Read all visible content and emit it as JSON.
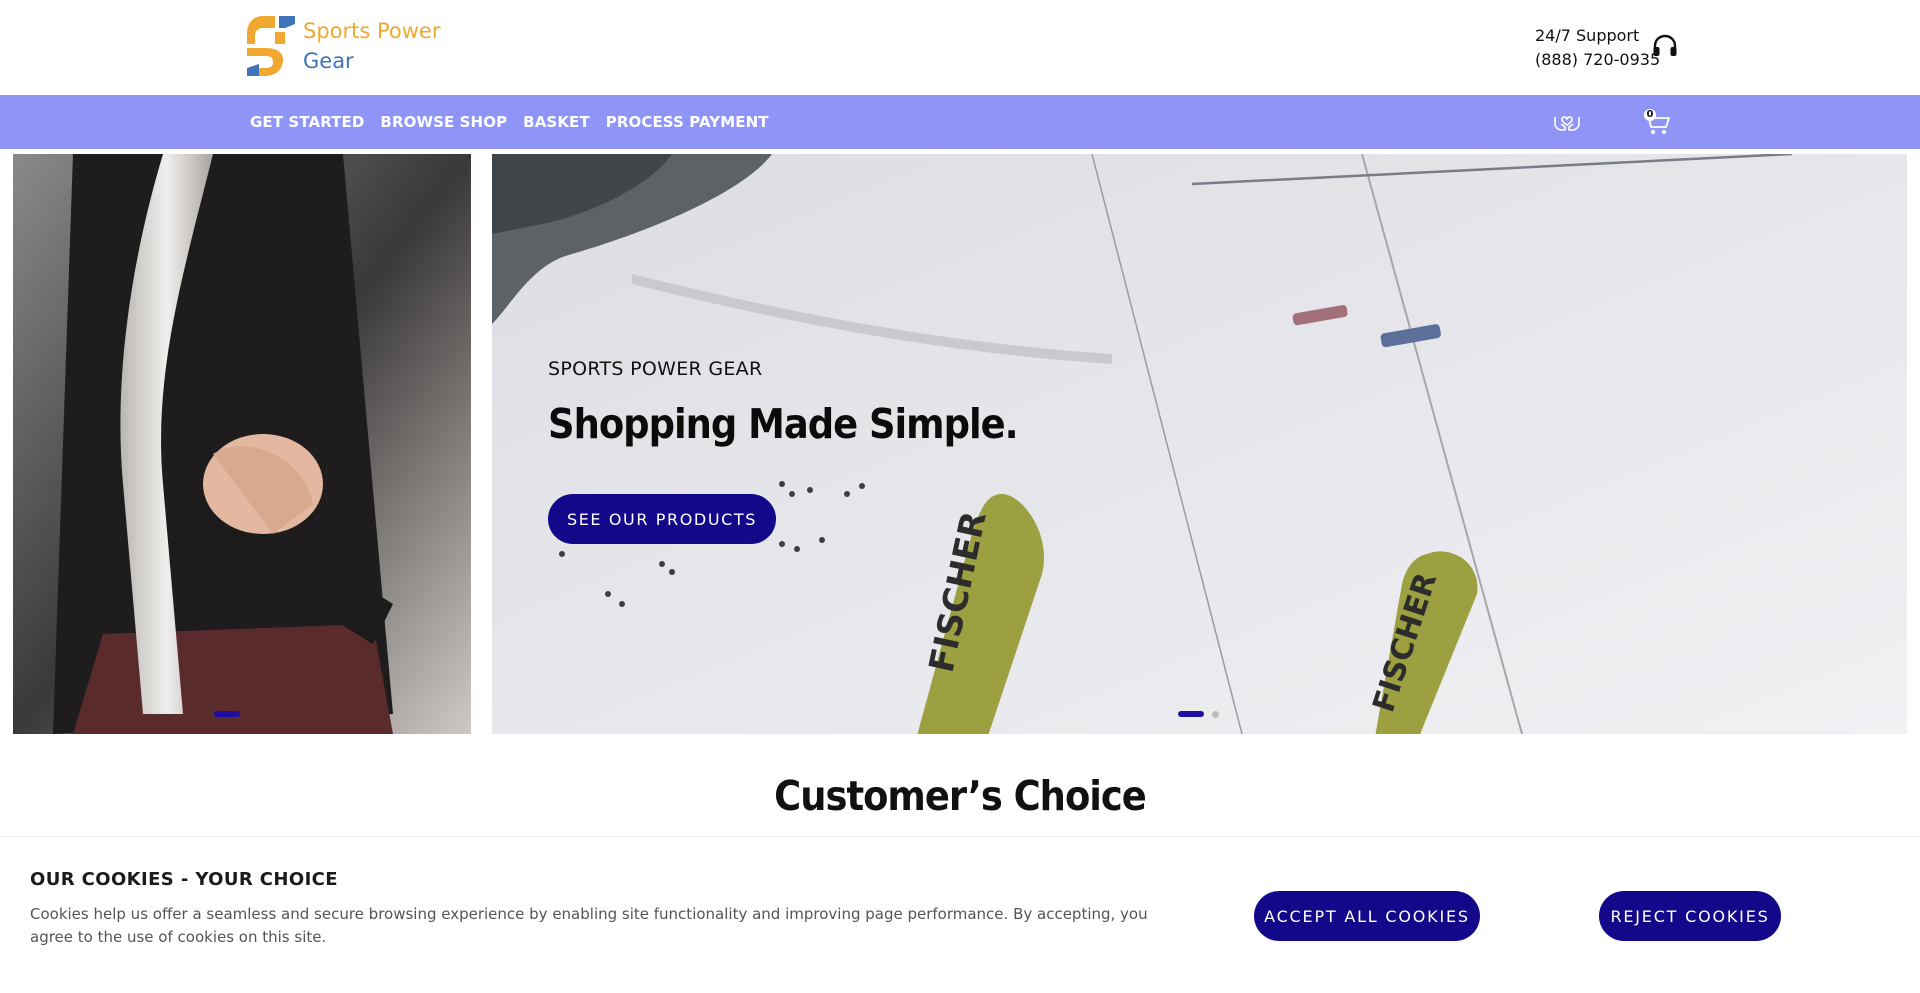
{
  "header": {
    "logo": {
      "line1": "Sports Power",
      "line2": "Gear",
      "colors": {
        "orange": "#f0a830",
        "blue": "#3f74b8"
      }
    },
    "support": {
      "label": "24/7 Support",
      "phone": "(888) 720-0935",
      "icon": "headphones-icon"
    }
  },
  "nav": {
    "background": "#8f95f7",
    "links": [
      "GET STARTED",
      "BROWSE SHOP",
      "BASKET",
      "PROCESS PAYMENT"
    ],
    "wishlist_icon": "hands-heart-icon",
    "cart": {
      "icon": "cart-icon",
      "count": "0"
    }
  },
  "hero": {
    "eyebrow": "SPORTS POWER GEAR",
    "title": "Shopping Made Simple.",
    "cta": "SEE OUR PRODUCTS",
    "accent": "#13088a"
  },
  "section": {
    "title": "Customer’s Choice"
  },
  "cookies": {
    "title": "OUR COOKIES - YOUR CHOICE",
    "text": "Cookies help us offer a seamless and secure browsing experience by enabling site functionality and improving page performance. By accepting, you agree to the use of cookies on this site.",
    "accept": "ACCEPT ALL COOKIES",
    "reject": "REJECT COOKIES"
  }
}
